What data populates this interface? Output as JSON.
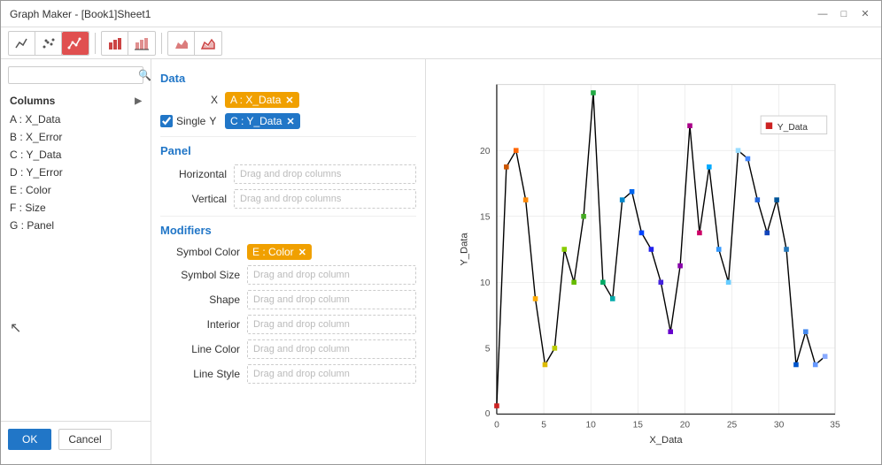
{
  "window": {
    "title": "Graph Maker - [Book1]Sheet1"
  },
  "controls": {
    "minimize": "—",
    "maximize": "□",
    "close": "✕"
  },
  "search": {
    "placeholder": ""
  },
  "columns_section": {
    "label": "Columns",
    "items": [
      {
        "id": "A",
        "name": "X_Data"
      },
      {
        "id": "B",
        "name": "X_Error"
      },
      {
        "id": "C",
        "name": "Y_Data"
      },
      {
        "id": "D",
        "name": "Y_Error"
      },
      {
        "id": "E",
        "name": "Color"
      },
      {
        "id": "F",
        "name": "Size"
      },
      {
        "id": "G",
        "name": "Panel"
      }
    ]
  },
  "buttons": {
    "ok": "OK",
    "cancel": "Cancel"
  },
  "data_section": {
    "title": "Data",
    "x_label": "X",
    "x_tag": "A : X_Data",
    "single_label": "Single",
    "y_label": "Y",
    "y_tag": "C : Y_Data"
  },
  "panel_section": {
    "title": "Panel",
    "horizontal_label": "Horizontal",
    "horizontal_placeholder": "Drag and drop columns",
    "vertical_label": "Vertical",
    "vertical_placeholder": "Drag and drop columns"
  },
  "modifiers_section": {
    "title": "Modifiers",
    "symbol_color_label": "Symbol Color",
    "symbol_color_tag": "E : Color",
    "symbol_size_label": "Symbol Size",
    "symbol_size_placeholder": "Drag and drop column",
    "shape_label": "Shape",
    "shape_placeholder": "Drag and drop column",
    "interior_label": "Interior",
    "interior_placeholder": "Drag and drop column",
    "line_color_label": "Line Color",
    "line_color_placeholder": "Drag and drop column",
    "line_style_label": "Line Style",
    "line_style_placeholder": "Drag and drop column"
  },
  "chart": {
    "legend_label": "Y_Data",
    "x_axis_label": "X_Data",
    "y_axis_label": "Y_Data"
  }
}
